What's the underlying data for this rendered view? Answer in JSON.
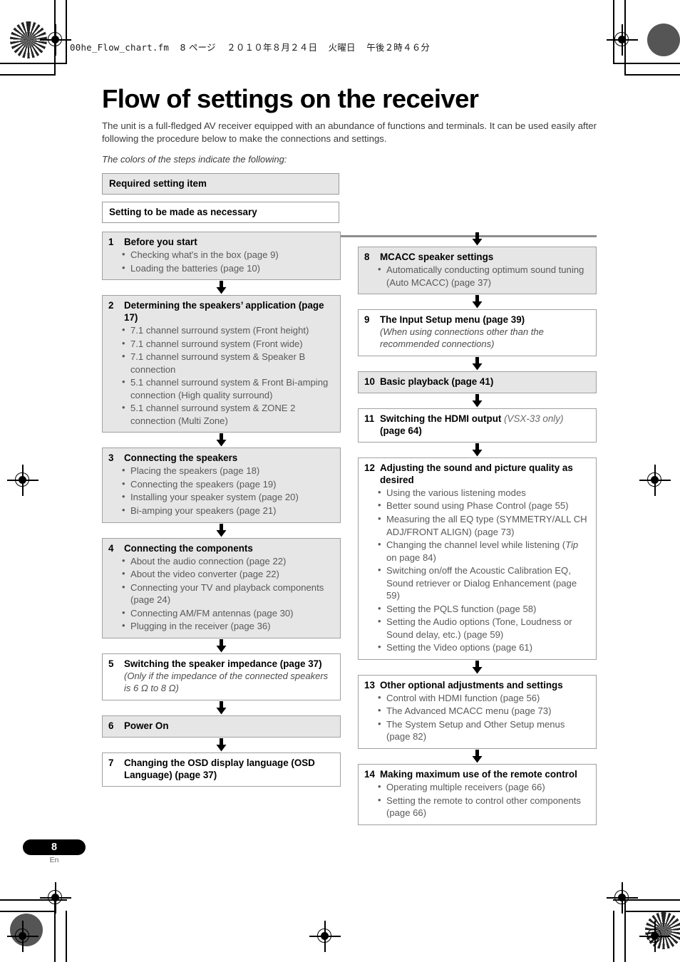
{
  "file_header": {
    "filename": "00he_Flow_chart.fm",
    "page_marker": "8 ページ",
    "date": "２０１０年８月２４日",
    "weekday": "火曜日",
    "time": "午後２時４６分"
  },
  "page": {
    "title": "Flow of settings on the receiver",
    "intro": "The unit is a full-fledged AV receiver equipped with an abundance of functions and terminals. It can be used easily after following the procedure below to make the connections and settings.",
    "legend_note": "The colors of the steps indicate the following:"
  },
  "legend": [
    {
      "label": "Required setting item",
      "style": "filled"
    },
    {
      "label": "Setting to be made as necessary",
      "style": "empty"
    }
  ],
  "colors": {
    "filled_background": "#e6e6e6",
    "empty_background": "#ffffff",
    "box_border": "#a0a0a0",
    "rule": "#8e8e8e",
    "body_text": "#595959",
    "heading_text": "#000000"
  },
  "left_column": [
    {
      "num": "1",
      "title": "Before you start",
      "style": "filled",
      "bullets": [
        "Checking what's in the box (page 9)",
        "Loading the batteries (page 10)"
      ]
    },
    {
      "num": "2",
      "title": "Determining the speakers’ application (page 17)",
      "style": "filled",
      "bullets": [
        "7.1 channel surround system (Front height)",
        "7.1 channel surround system (Front wide)",
        "7.1 channel surround system & Speaker B connection",
        "5.1 channel surround system & Front Bi-amping connection (High quality surround)",
        "5.1 channel surround system & ZONE 2 connection (Multi Zone)"
      ]
    },
    {
      "num": "3",
      "title": "Connecting the speakers",
      "style": "filled",
      "bullets": [
        "Placing the speakers (page 18)",
        "Connecting the speakers (page 19)",
        "Installing your speaker system (page 20)",
        "Bi-amping your speakers (page 21)"
      ]
    },
    {
      "num": "4",
      "title": "Connecting the components",
      "style": "filled",
      "bullets": [
        "About the audio connection (page 22)",
        "About the video converter (page 22)",
        "Connecting your TV and playback components (page 24)",
        "Connecting AM/FM antennas (page 30)",
        "Plugging in the receiver (page 36)"
      ]
    },
    {
      "num": "5",
      "title": "Switching the speaker impedance (page 37)",
      "style": "empty",
      "note": "(Only if the impedance of the connected speakers is 6 Ω to 8 Ω)",
      "bullets": []
    },
    {
      "num": "6",
      "title": "Power On",
      "style": "filled",
      "bullets": []
    },
    {
      "num": "7",
      "title": "Changing the OSD display language (OSD Language) (page 37)",
      "style": "empty",
      "bullets": []
    }
  ],
  "right_column": [
    {
      "num": "8",
      "title": "MCACC speaker settings",
      "style": "filled",
      "bullets": [
        "Automatically conducting optimum sound tuning (Auto MCACC) (page 37)"
      ]
    },
    {
      "num": "9",
      "title": "The Input Setup menu (page 39)",
      "style": "empty",
      "note": "(When using connections other than the recommended connections)",
      "bullets": []
    },
    {
      "num": "10",
      "title": "Basic playback (page 41)",
      "style": "filled",
      "bullets": []
    },
    {
      "num": "11",
      "title_pre": "Switching the HDMI output ",
      "title_note": "(VSX-33 only)",
      "title_post": " (page 64)",
      "style": "empty",
      "bullets": []
    },
    {
      "num": "12",
      "title": "Adjusting the sound and picture quality as desired",
      "style": "empty",
      "bullets": [
        "Using the various listening modes",
        "Better sound using Phase Control (page 55)",
        "Measuring the all EQ type (SYMMETRY/ALL CH ADJ/FRONT ALIGN) (page 73)",
        "Changing the channel level while listening (Tip on page 84)",
        "Switching on/off the Acoustic Calibration EQ, Sound retriever or Dialog Enhancement (page 59)",
        "Setting the PQLS function (page 58)",
        "Setting the Audio options (Tone, Loudness or Sound delay, etc.) (page 59)",
        "Setting the Video options (page 61)"
      ]
    },
    {
      "num": "13",
      "title": "Other optional adjustments and settings",
      "style": "empty",
      "bullets": [
        "Control with HDMI function (page 56)",
        "The Advanced MCACC menu (page 73)",
        "The System Setup and Other Setup menus (page 82)"
      ]
    },
    {
      "num": "14",
      "title": "Making maximum use of the remote control",
      "style": "empty",
      "bullets": [
        "Operating multiple receivers (page 66)",
        "Setting the remote to control other components (page 66)"
      ]
    }
  ],
  "footer": {
    "page_number": "8",
    "language_code": "En"
  }
}
